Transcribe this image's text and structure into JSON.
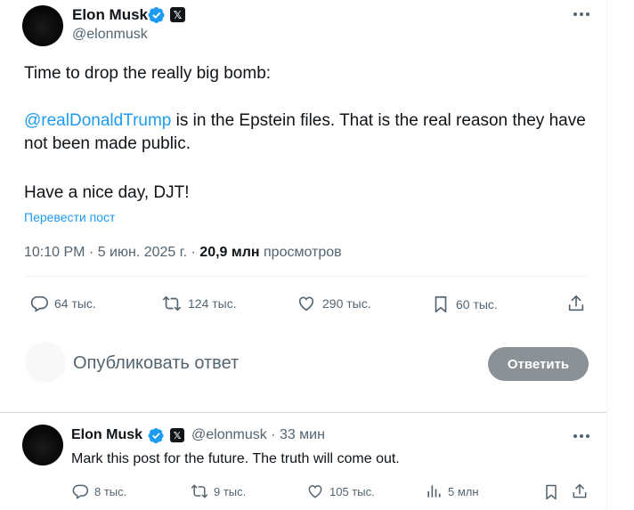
{
  "tweet": {
    "author_name": "Elon Musk",
    "author_handle": "@elonmusk",
    "paragraphs": {
      "p1": "Time to drop the really big bomb:",
      "mention": "@realDonaldTrump",
      "p2_rest": " is in the Epstein files. That is the real reason they have not been made public.",
      "p3": "Have a nice day, DJT!"
    },
    "translate_label": "Перевести пост",
    "time": "10:10 PM",
    "date": "5 июн. 2025 г.",
    "views_count": "20,9 млн",
    "views_label": "просмотров",
    "actions": {
      "replies": "64 тыс.",
      "reposts": "124 тыс.",
      "likes": "290 тыс.",
      "bookmarks": "60 тыс."
    }
  },
  "composer": {
    "placeholder": "Опубликовать ответ",
    "button_label": "Ответить"
  },
  "reply_tweet": {
    "author_name": "Elon Musk",
    "author_handle": "@elonmusk",
    "time_ago": "33 мин",
    "text": "Mark this post for the future. The truth will come out.",
    "actions": {
      "replies": "8 тыс.",
      "reposts": "9 тыс.",
      "likes": "105 тыс.",
      "views": "5 млн"
    }
  },
  "icons": {
    "verified": "verified-badge-icon",
    "x_logo": "x-logo-icon",
    "more": "more-icon",
    "reply": "reply-icon",
    "repost": "repost-icon",
    "like": "like-icon",
    "bookmark": "bookmark-icon",
    "share": "share-icon",
    "views": "views-icon"
  },
  "colors": {
    "accent": "#1d9bf0",
    "text": "#0f1419",
    "secondary": "#536471",
    "button_disabled": "#8b9297"
  }
}
